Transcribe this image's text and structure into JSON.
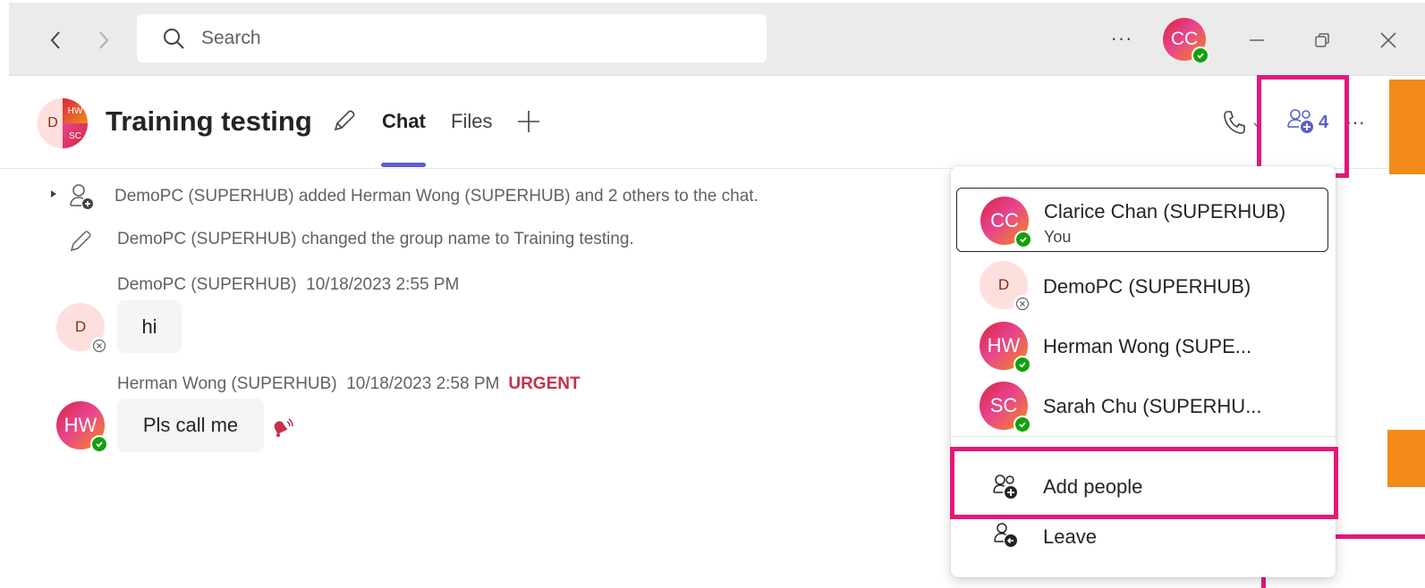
{
  "titlebar": {
    "search_placeholder": "Search",
    "more_label": "···",
    "user_initials": "CC"
  },
  "chat": {
    "title": "Training testing",
    "group_avatar": {
      "d": "D",
      "hw": "HW",
      "sc": "SC"
    },
    "tabs": [
      {
        "label": "Chat",
        "active": true
      },
      {
        "label": "Files",
        "active": false
      }
    ],
    "participant_count": "4",
    "more_label": "···"
  },
  "messages": {
    "system": [
      "DemoPC (SUPERHUB) added Herman Wong (SUPERHUB) and 2 others to the chat.",
      "DemoPC (SUPERHUB) changed the group name to Training testing."
    ],
    "items": [
      {
        "author": "DemoPC (SUPERHUB)",
        "time": "10/18/2023 2:55 PM",
        "text": "hi",
        "initials": "D",
        "urgent": ""
      },
      {
        "author": "Herman Wong (SUPERHUB)",
        "time": "10/18/2023 2:58 PM",
        "text": "Pls call me",
        "initials": "HW",
        "urgent": "URGENT"
      }
    ]
  },
  "participants_panel": {
    "members": [
      {
        "initials": "CC",
        "name": "Clarice Chan (SUPERHUB)",
        "sub": "You"
      },
      {
        "initials": "D",
        "name": "DemoPC (SUPERHUB)",
        "sub": ""
      },
      {
        "initials": "HW",
        "name": "Herman Wong (SUPE...",
        "sub": ""
      },
      {
        "initials": "SC",
        "name": "Sarah Chu (SUPERHU...",
        "sub": ""
      }
    ],
    "actions": [
      {
        "label": "Add people"
      },
      {
        "label": "Leave"
      }
    ]
  },
  "colors": {
    "accent": "#5b5fc7",
    "highlight": "#e3197a",
    "urgent": "#c4314b",
    "presence_available": "#13a10e",
    "orange": "#f28b1a"
  }
}
